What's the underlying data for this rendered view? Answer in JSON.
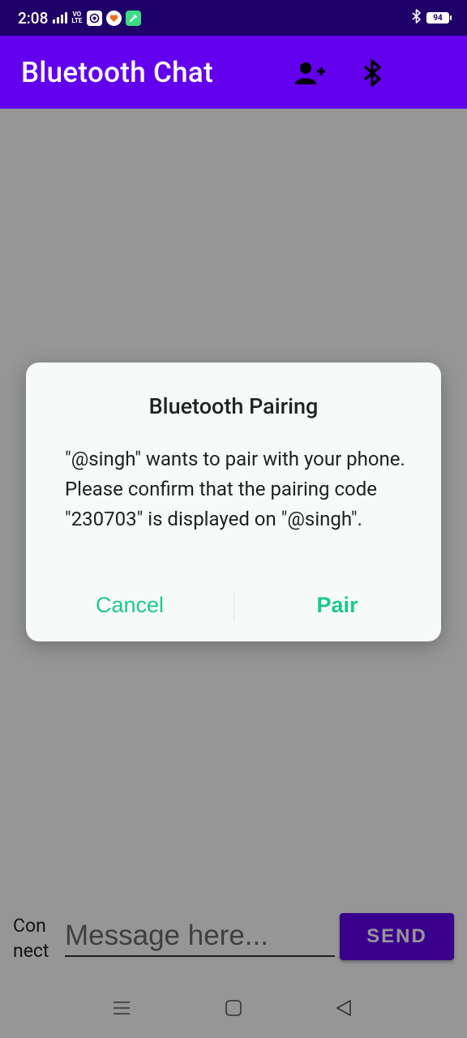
{
  "status_bar": {
    "time": "2:08",
    "network_label_top": "VO",
    "network_label_bottom": "LTE",
    "battery": "94"
  },
  "app_bar": {
    "title": "Bluetooth Chat",
    "add_device_icon": "person-add-icon",
    "bluetooth_icon": "bluetooth-icon"
  },
  "composer": {
    "connect_label": "Connect",
    "message_placeholder": "Message here...",
    "send_label": "SEND"
  },
  "dialog": {
    "title": "Bluetooth Pairing",
    "message": "\"@singh\" wants to pair with your phone. Please confirm that the pairing code \"230703\" is displayed on \"@singh\".",
    "cancel_label": "Cancel",
    "pair_label": "Pair"
  },
  "colors": {
    "status_bar": "#1e0068",
    "primary": "#6200ee",
    "dialog_action": "#1ec88a",
    "dialog_background": "#f6fbfa"
  }
}
